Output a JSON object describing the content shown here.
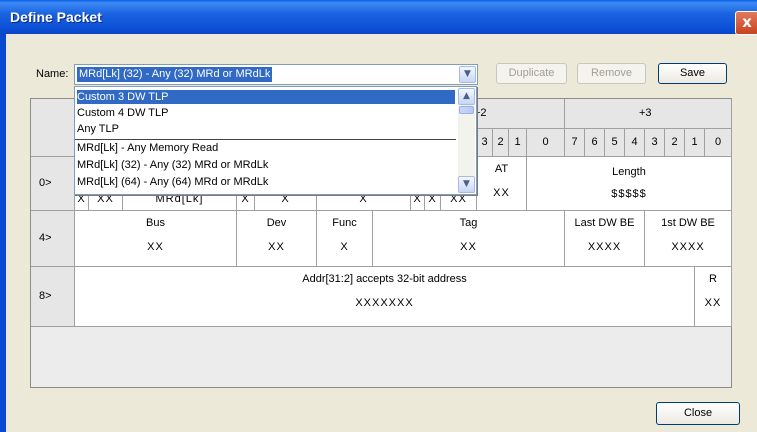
{
  "window": {
    "title": "Define Packet",
    "close_glyph": "x"
  },
  "name_field": {
    "label": "Name:",
    "value": "MRd[Lk] (32) - Any (32) MRd or MRdLk"
  },
  "buttons": {
    "duplicate": "Duplicate",
    "remove": "Remove",
    "save": "Save",
    "close": "Close"
  },
  "dropdown": {
    "items": [
      "Custom 3 DW TLP",
      "Custom 4 DW TLP",
      "Any TLP",
      "MRd[Lk] - Any Memory Read",
      "MRd[Lk] (32) - Any (32) MRd or MRdLk",
      "MRd[Lk] (64) - Any (64) MRd or MRdLk"
    ],
    "selected_index": 0
  },
  "grid": {
    "byte_headers": [
      "+2",
      "+3"
    ],
    "bit_labels_plus2": [
      "3",
      "2",
      "1",
      "0"
    ],
    "bit_labels_plus3": [
      "7",
      "6",
      "5",
      "4",
      "3",
      "2",
      "1",
      "0"
    ],
    "row_labels": [
      "0>",
      "4>",
      "8>"
    ],
    "row0": {
      "partial_values": [
        "X",
        "XX",
        "MRd[Lk]",
        "X",
        "X",
        "X",
        "X",
        "X",
        "XX"
      ],
      "at_label": "AT",
      "at_value": "XX",
      "length_label": "Length",
      "length_value": "$$$$$"
    },
    "row1": [
      {
        "label": "Bus",
        "value": "XX"
      },
      {
        "label": "Dev",
        "value": "XX"
      },
      {
        "label": "Func",
        "value": "X"
      },
      {
        "label": "Tag",
        "value": "XX"
      },
      {
        "label": "Last DW BE",
        "value": "XXXX"
      },
      {
        "label": "1st DW BE",
        "value": "XXXX"
      }
    ],
    "row2": [
      {
        "label": "Addr[31:2] accepts 32-bit address",
        "value": "XXXXXXX"
      },
      {
        "label": "R",
        "value": "XX"
      }
    ]
  }
}
